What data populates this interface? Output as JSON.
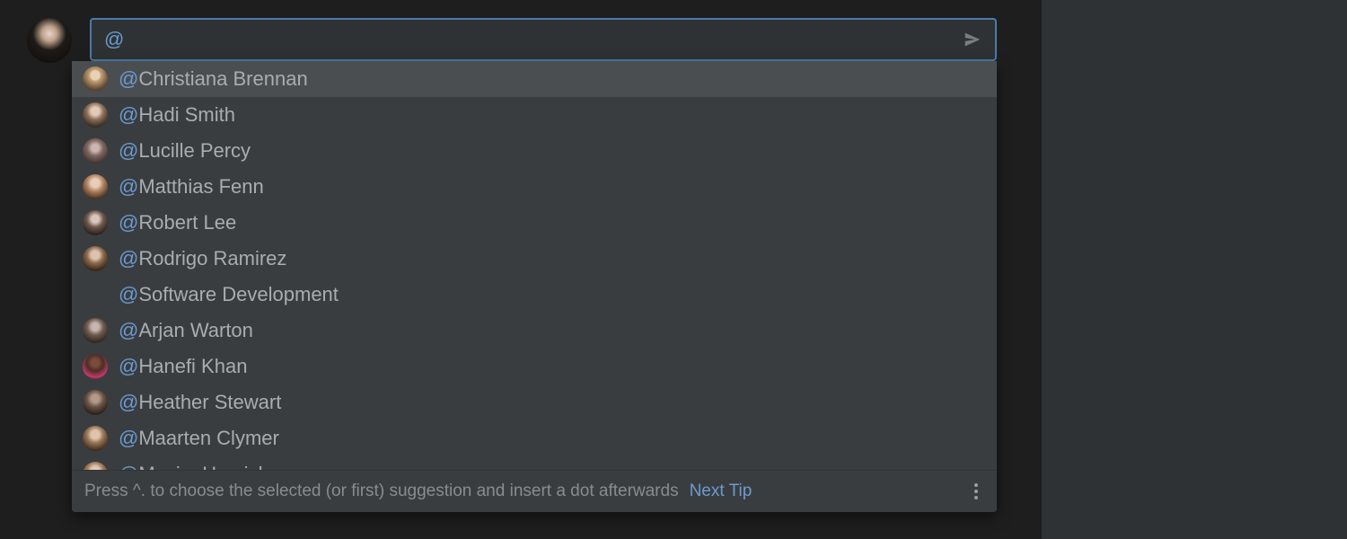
{
  "colors": {
    "accent": "#6b9bd1",
    "input_border": "#4a7baa",
    "panel_bg": "#2f3234",
    "dropdown_bg": "#3a3d3f",
    "highlight_bg": "#4b4e50"
  },
  "compose": {
    "input_value": "@",
    "placeholder": ""
  },
  "suggestions": [
    {
      "at": "@",
      "name": "Christiana Brennan",
      "has_avatar": true,
      "highlighted": true
    },
    {
      "at": "@",
      "name": "Hadi Smith",
      "has_avatar": true,
      "highlighted": false
    },
    {
      "at": "@",
      "name": "Lucille Percy",
      "has_avatar": true,
      "highlighted": false
    },
    {
      "at": "@",
      "name": "Matthias Fenn",
      "has_avatar": true,
      "highlighted": false
    },
    {
      "at": "@",
      "name": "Robert Lee",
      "has_avatar": true,
      "highlighted": false
    },
    {
      "at": "@",
      "name": "Rodrigo Ramirez",
      "has_avatar": true,
      "highlighted": false
    },
    {
      "at": "@",
      "name": "Software Development",
      "has_avatar": false,
      "highlighted": false
    },
    {
      "at": "@",
      "name": "Arjan Warton",
      "has_avatar": true,
      "highlighted": false
    },
    {
      "at": "@",
      "name": "Hanefi Khan",
      "has_avatar": true,
      "highlighted": false
    },
    {
      "at": "@",
      "name": "Heather Stewart",
      "has_avatar": true,
      "highlighted": false
    },
    {
      "at": "@",
      "name": "Maarten Clymer",
      "has_avatar": true,
      "highlighted": false
    },
    {
      "at": "@",
      "name": "Maxim Harvick",
      "has_avatar": true,
      "highlighted": false
    }
  ],
  "footer": {
    "hint": "Press ^. to choose the selected (or first) suggestion and insert a dot afterwards",
    "link": "Next Tip"
  }
}
